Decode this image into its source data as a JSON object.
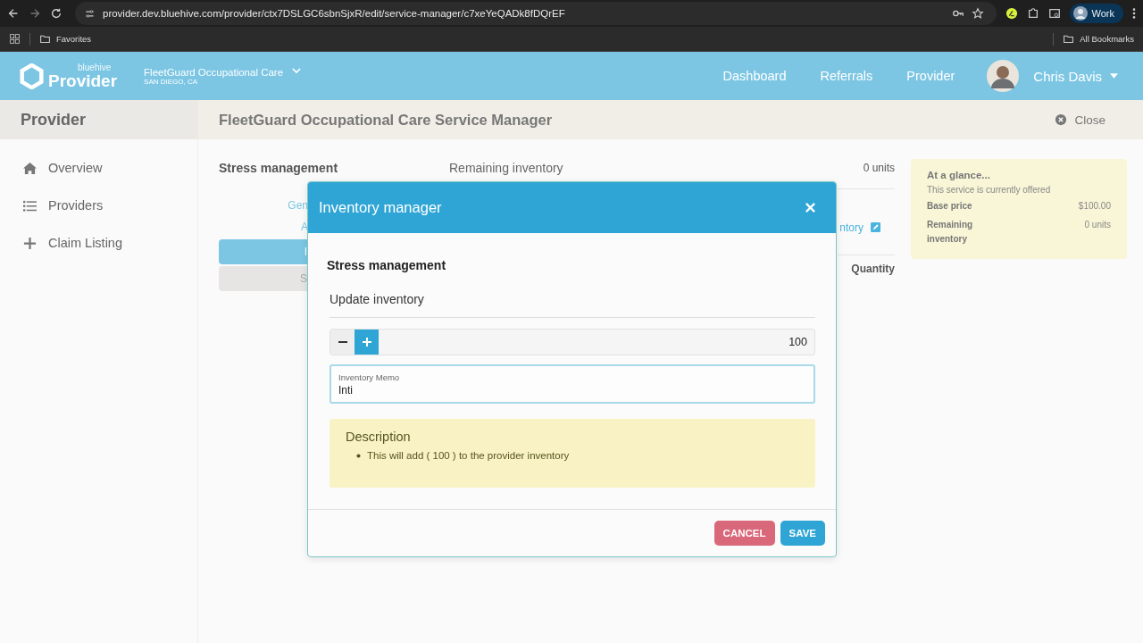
{
  "browser": {
    "url": "provider.dev.bluehive.com/provider/ctx7DSLGC6sbnSjxR/edit/service-manager/c7xeYeQADk8fDQrEF",
    "favorites": "Favorites",
    "all_bookmarks": "All Bookmarks",
    "profile": "Work"
  },
  "header": {
    "brand_small": "bluehive",
    "brand": "Provider",
    "org": "FleetGuard Occupational Care",
    "location": "SAN DIEGO, CA",
    "nav": [
      "Dashboard",
      "Referrals",
      "Provider"
    ],
    "user": "Chris Davis"
  },
  "subheader": {
    "section": "Provider",
    "title": "FleetGuard Occupational Care Service Manager",
    "close": "Close"
  },
  "sidebar": {
    "items": [
      {
        "label": "Overview",
        "kind": "home"
      },
      {
        "label": "Providers",
        "kind": "list"
      },
      {
        "label": "Claim Listing",
        "kind": "plus"
      }
    ]
  },
  "service": {
    "name": "Stress management",
    "remaining_label": "Remaining inventory",
    "remaining_value": "0 units",
    "tabs": [
      {
        "label": "Gen",
        "kind": "link",
        "selected": false
      },
      {
        "label": "A",
        "kind": "link",
        "selected": false
      },
      {
        "label": "I",
        "kind": "pill",
        "selected": true
      },
      {
        "label": "S",
        "kind": "pill",
        "selected": false
      }
    ],
    "edit_link": "ntory",
    "column": "Quantity"
  },
  "glance": {
    "title": "At a glance...",
    "status": "This service is currently offered",
    "rows": [
      {
        "label": "Base price",
        "value": "$100.00"
      },
      {
        "label": "Remaining inventory",
        "value": "0 units"
      }
    ]
  },
  "modal": {
    "title": "Inventory manager",
    "service": "Stress management",
    "section": "Update inventory",
    "quantity": "100",
    "memo": {
      "label": "Inventory Memo",
      "value": "Inti"
    },
    "description": {
      "title": "Description",
      "items": [
        "This will add ( 100 ) to the provider inventory"
      ]
    },
    "buttons": [
      {
        "label": "CANCEL",
        "kind": "cancel"
      },
      {
        "label": "SAVE",
        "kind": "save"
      }
    ]
  }
}
